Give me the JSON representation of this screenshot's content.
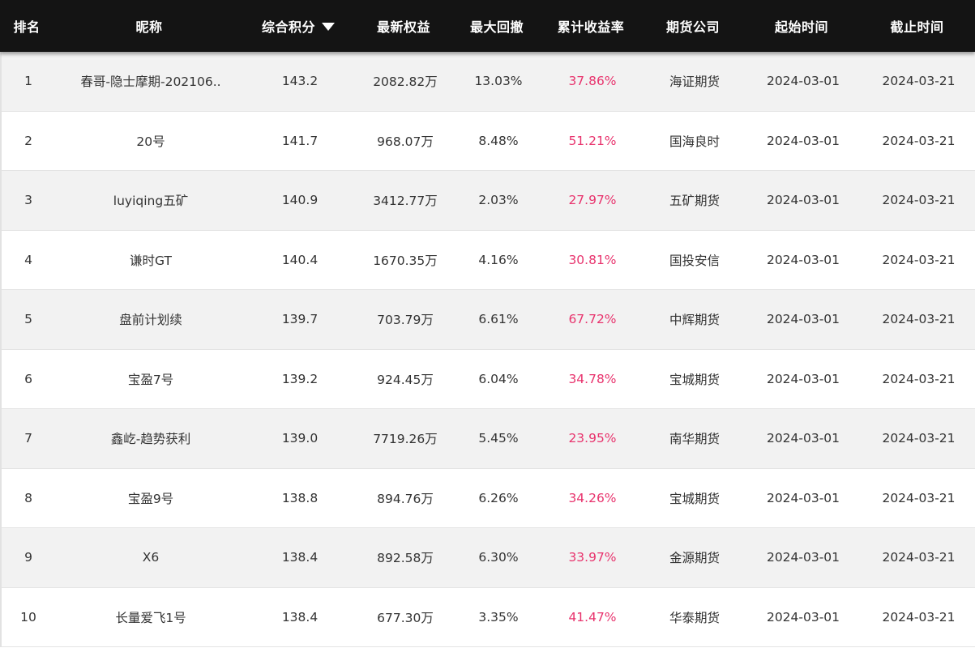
{
  "header": {
    "rank": "排名",
    "nickname": "昵称",
    "score": "综合积分",
    "equity": "最新权益",
    "drawdown": "最大回撤",
    "return": "累计收益率",
    "company": "期货公司",
    "start": "起始时间",
    "end": "截止时间"
  },
  "colors": {
    "header_bg": "#141414",
    "return_color": "#e8336d",
    "odd_row_bg": "#f2f2f2"
  },
  "rows": [
    {
      "rank": "1",
      "nickname": "春哥-隐士摩期-202106..",
      "score": "143.2",
      "equity": "2082.82万",
      "drawdown": "13.03%",
      "return": "37.86%",
      "company": "海证期货",
      "start": "2024-03-01",
      "end": "2024-03-21"
    },
    {
      "rank": "2",
      "nickname": "20号",
      "score": "141.7",
      "equity": "968.07万",
      "drawdown": "8.48%",
      "return": "51.21%",
      "company": "国海良时",
      "start": "2024-03-01",
      "end": "2024-03-21"
    },
    {
      "rank": "3",
      "nickname": "luyiqing五矿",
      "score": "140.9",
      "equity": "3412.77万",
      "drawdown": "2.03%",
      "return": "27.97%",
      "company": "五矿期货",
      "start": "2024-03-01",
      "end": "2024-03-21"
    },
    {
      "rank": "4",
      "nickname": "谦时GT",
      "score": "140.4",
      "equity": "1670.35万",
      "drawdown": "4.16%",
      "return": "30.81%",
      "company": "国投安信",
      "start": "2024-03-01",
      "end": "2024-03-21"
    },
    {
      "rank": "5",
      "nickname": "盘前计划续",
      "score": "139.7",
      "equity": "703.79万",
      "drawdown": "6.61%",
      "return": "67.72%",
      "company": "中辉期货",
      "start": "2024-03-01",
      "end": "2024-03-21"
    },
    {
      "rank": "6",
      "nickname": "宝盈7号",
      "score": "139.2",
      "equity": "924.45万",
      "drawdown": "6.04%",
      "return": "34.78%",
      "company": "宝城期货",
      "start": "2024-03-01",
      "end": "2024-03-21"
    },
    {
      "rank": "7",
      "nickname": "鑫屹-趋势获利",
      "score": "139.0",
      "equity": "7719.26万",
      "drawdown": "5.45%",
      "return": "23.95%",
      "company": "南华期货",
      "start": "2024-03-01",
      "end": "2024-03-21"
    },
    {
      "rank": "8",
      "nickname": "宝盈9号",
      "score": "138.8",
      "equity": "894.76万",
      "drawdown": "6.26%",
      "return": "34.26%",
      "company": "宝城期货",
      "start": "2024-03-01",
      "end": "2024-03-21"
    },
    {
      "rank": "9",
      "nickname": "X6",
      "score": "138.4",
      "equity": "892.58万",
      "drawdown": "6.30%",
      "return": "33.97%",
      "company": "金源期货",
      "start": "2024-03-01",
      "end": "2024-03-21"
    },
    {
      "rank": "10",
      "nickname": "长量爱飞1号",
      "score": "138.4",
      "equity": "677.30万",
      "drawdown": "3.35%",
      "return": "41.47%",
      "company": "华泰期货",
      "start": "2024-03-01",
      "end": "2024-03-21"
    }
  ]
}
